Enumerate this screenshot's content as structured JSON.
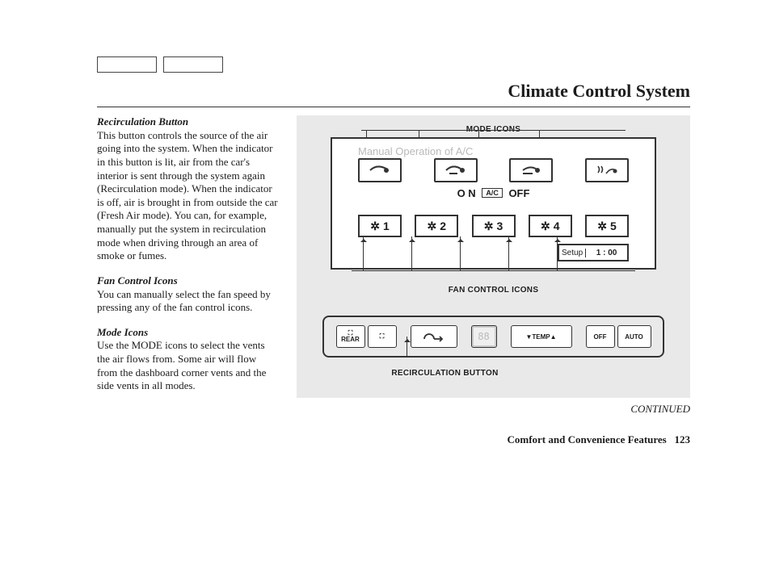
{
  "page": {
    "title": "Climate Control System",
    "continued": "CONTINUED",
    "footer_section": "Comfort and Convenience Features",
    "page_number": "123"
  },
  "text": {
    "recirc_h": "Recirculation Button",
    "recirc_p": "This button controls the source of the air going into the system. When the indicator in this button is lit, air from the car's interior is sent through the system again (Recirculation mode). When the indicator is off, air is brought in from outside the car (Fresh Air mode). You can, for example, manually put the system in recirculation mode when driving through an area of smoke or fumes.",
    "fan_h": "Fan Control Icons",
    "fan_p": "You can manually select the fan speed by pressing any of the fan control icons.",
    "mode_h": "Mode Icons",
    "mode_p": "Use the MODE icons to select the vents the air flows from. Some air will flow from the dashboard corner vents and the side vents in all modes."
  },
  "fig": {
    "cap_mode": "MODE ICONS",
    "cap_fan": "FAN CONTROL ICONS",
    "cap_recirc": "RECIRCULATION BUTTON",
    "ghost": "Manual Operation of A/C",
    "ac_on": "O N",
    "ac_chip": "A/C",
    "ac_off": "OFF",
    "fan_labels": [
      "1",
      "2",
      "3",
      "4",
      "5"
    ],
    "setup_lbl": "Setup",
    "setup_clock": "1 : 00",
    "rear": "REAR",
    "temp": "TEMP",
    "off": "OFF",
    "auto": "AUTO",
    "disp": "88"
  }
}
